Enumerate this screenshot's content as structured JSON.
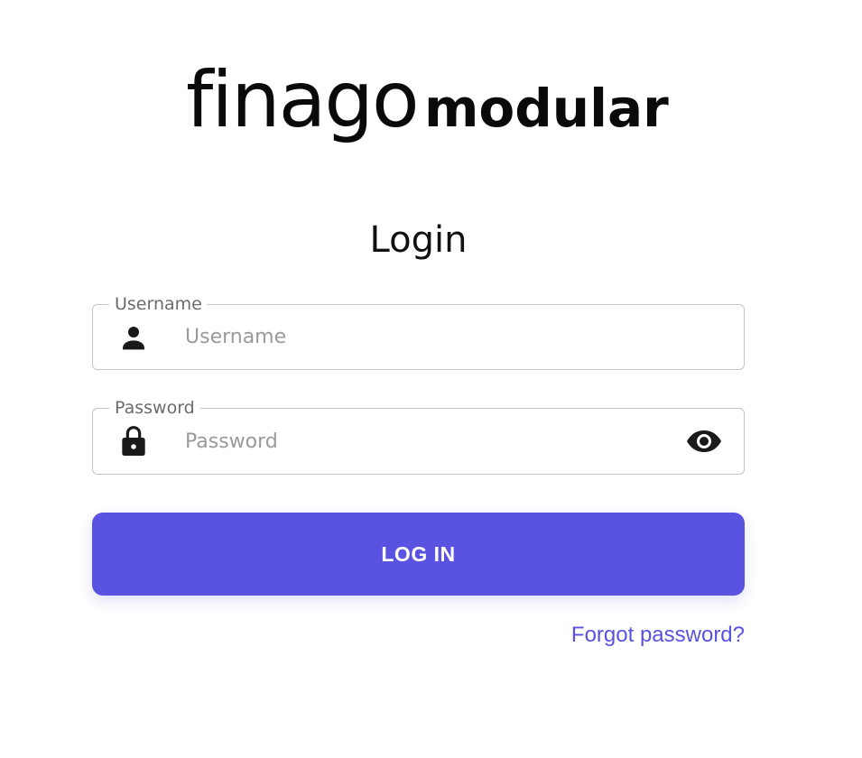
{
  "brand": {
    "name_primary": "finago",
    "name_secondary": "modular"
  },
  "login": {
    "title": "Login",
    "username": {
      "label": "Username",
      "placeholder": "Username",
      "value": "",
      "icon": "person-icon"
    },
    "password": {
      "label": "Password",
      "placeholder": "Password",
      "value": "",
      "icon": "lock-icon",
      "toggle_icon": "eye-icon"
    },
    "submit_label": "LOG IN",
    "forgot_label": "Forgot password?"
  },
  "colors": {
    "accent": "#5a52e0",
    "text": "#111111",
    "border": "#c4c4c4",
    "placeholder": "#9a9a9a"
  }
}
